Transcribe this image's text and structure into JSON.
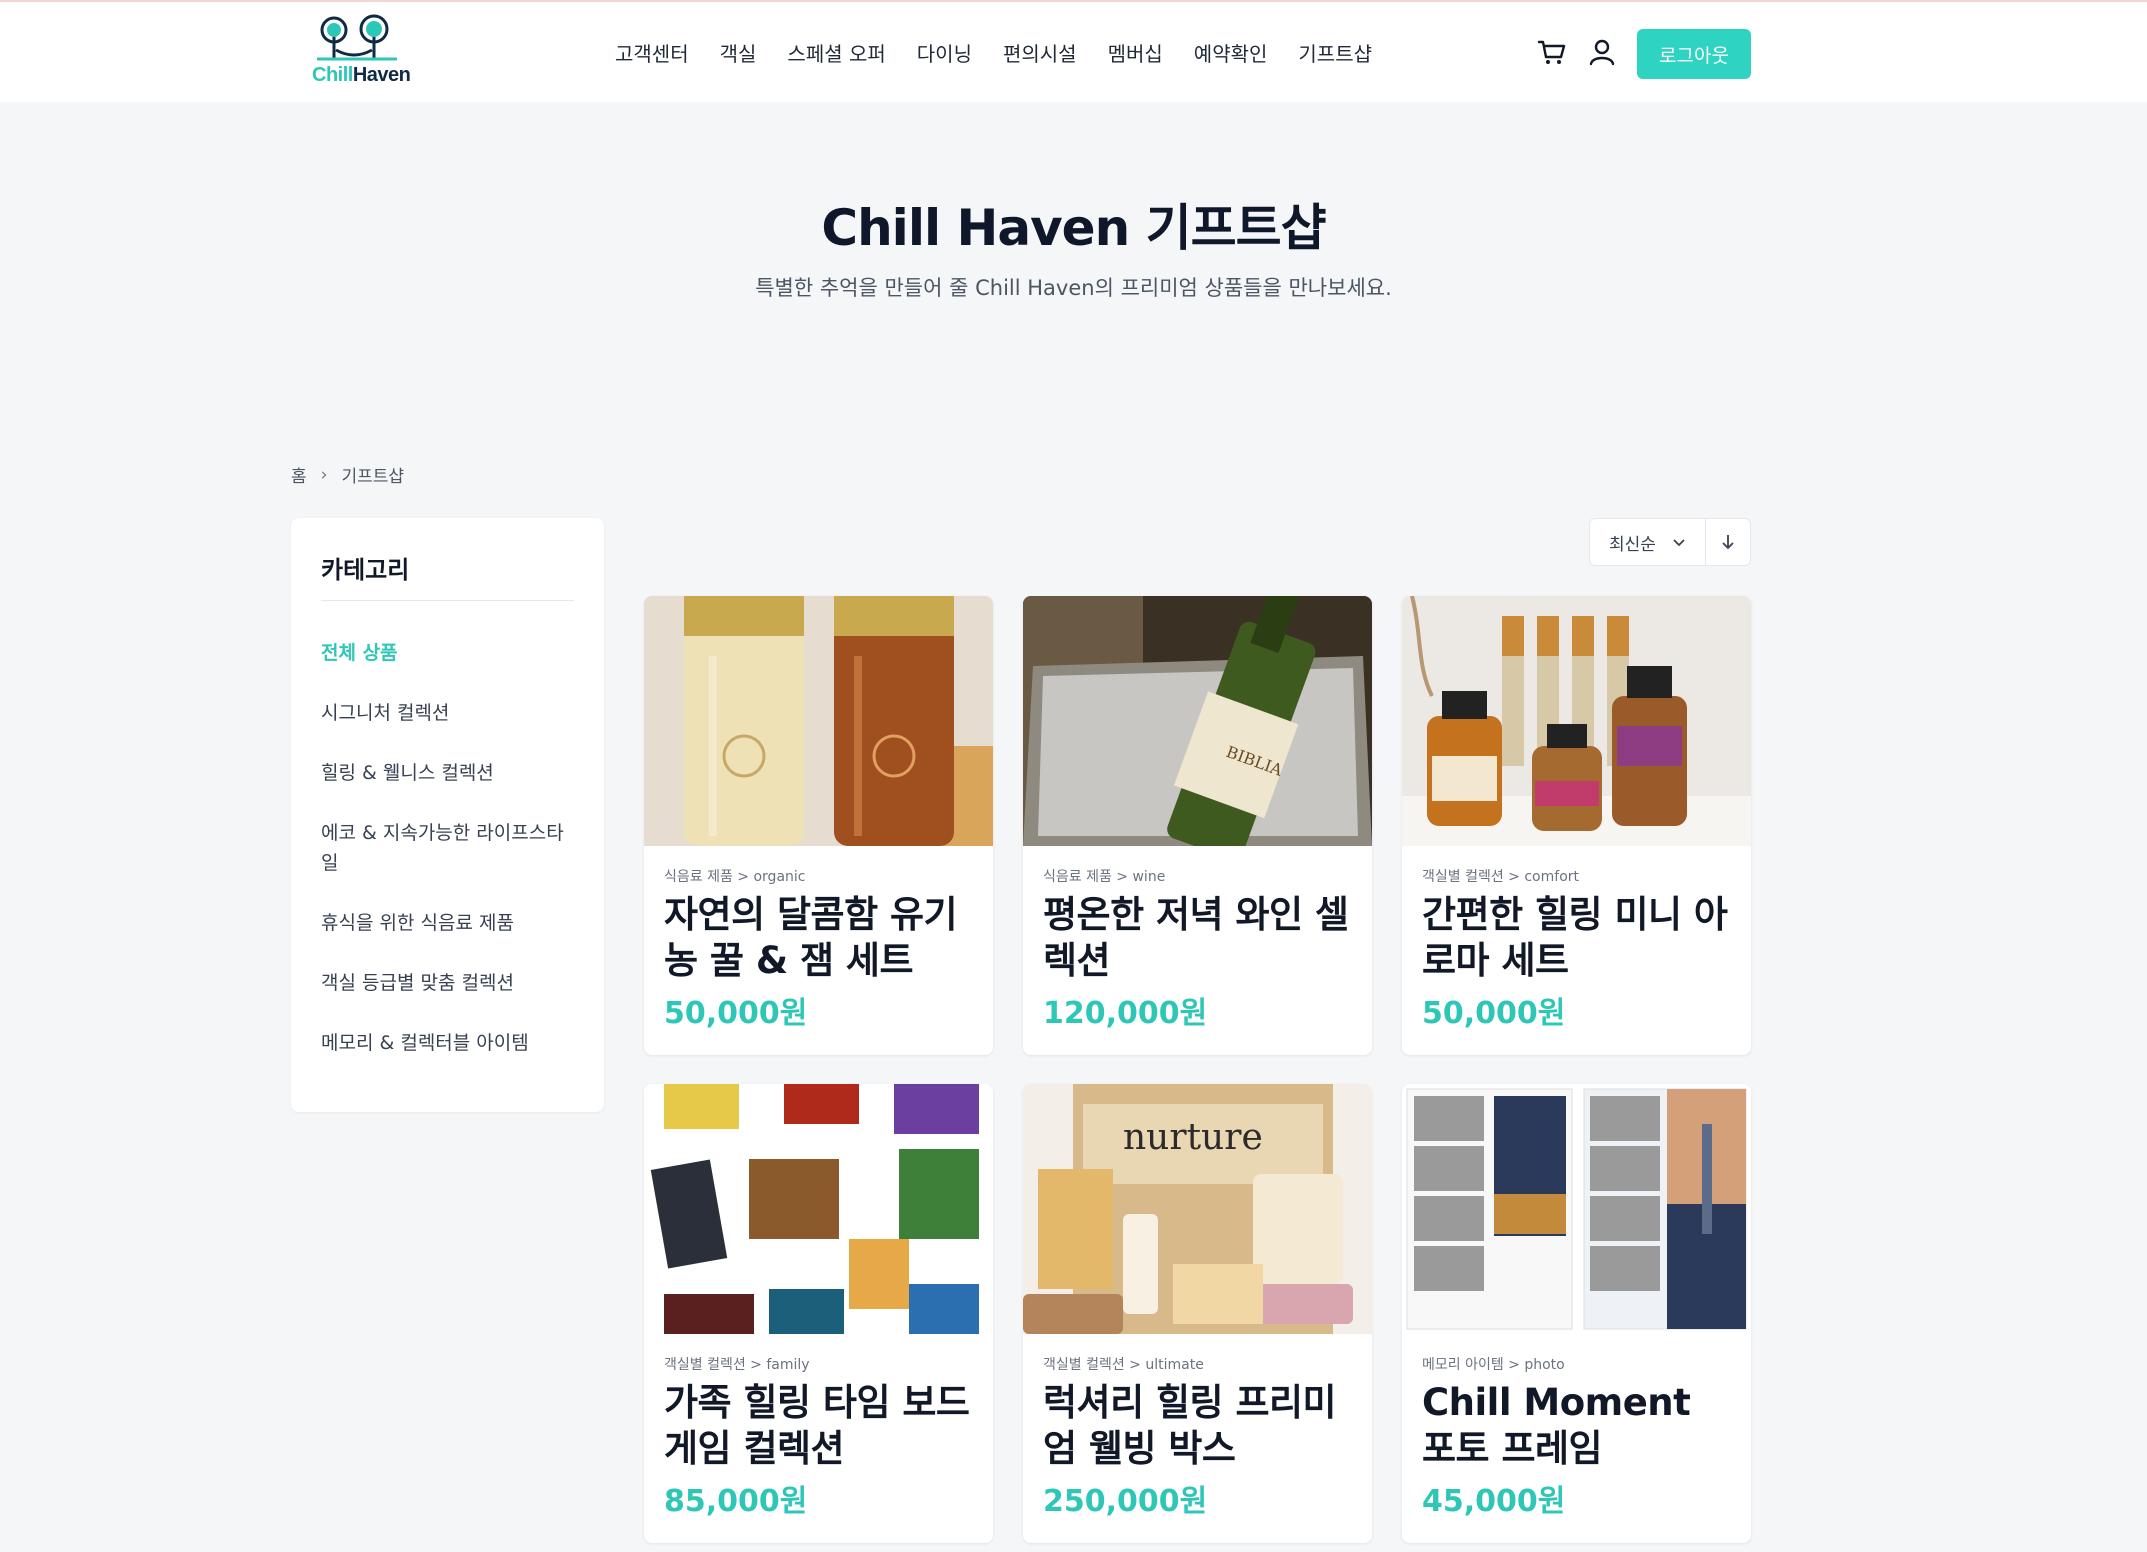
{
  "brand": {
    "chill": "Chill",
    "haven": "Haven",
    "accent": "#2ed3c1",
    "navy": "#0f2a44"
  },
  "nav": {
    "items": [
      "고객센터",
      "객실",
      "스페셜 오퍼",
      "다이닝",
      "편의시설",
      "멤버십",
      "예약확인",
      "기프트샵"
    ],
    "cart_icon": "cart-icon",
    "user_icon": "user-icon",
    "logout_label": "로그아웃"
  },
  "hero": {
    "title": "Chill Haven 기프트샵",
    "subtitle": "특별한 추억을 만들어 줄 Chill Haven의 프리미엄 상품들을 만나보세요."
  },
  "breadcrumb": {
    "home": "홈",
    "current": "기프트샵"
  },
  "sidebar": {
    "title": "카테고리",
    "items": [
      "전체 상품",
      "시그니처 컬렉션",
      "힐링 & 웰니스 컬렉션",
      "에코 & 지속가능한 라이프스타일",
      "휴식을 위한 식음료 제품",
      "객실 등급별 맞춤 컬렉션",
      "메모리 & 컬렉터블 아이템"
    ],
    "active_index": 0
  },
  "sort": {
    "selected": "최신순",
    "direction_icon": "arrow-down-icon"
  },
  "products": [
    {
      "category": "식음료 제품 > organic",
      "title": "자연의 달콤함 유기농 꿀 & 잼 세트",
      "price": "50,000원",
      "image": "honey-jars"
    },
    {
      "category": "식음료 제품 > wine",
      "title": "평온한 저녁 와인 셀렉션",
      "price": "120,000원",
      "image": "wine-bottle"
    },
    {
      "category": "객실별 컬렉션 > comfort",
      "title": "간편한 힐링 미니 아로마 세트",
      "price": "50,000원",
      "image": "aroma-bottles"
    },
    {
      "category": "객실별 컬렉션 > family",
      "title": "가족 힐링 타임 보드게임 컬렉션",
      "price": "85,000원",
      "image": "board-games"
    },
    {
      "category": "객실별 컬렉션 > ultimate",
      "title": "럭셔리 힐링 프리미엄 웰빙 박스",
      "price": "250,000원",
      "image": "wellbeing-box"
    },
    {
      "category": "메모리 아이템 > photo",
      "title": "Chill Moment 포토 프레임",
      "price": "45,000원",
      "image": "photo-frame"
    }
  ]
}
